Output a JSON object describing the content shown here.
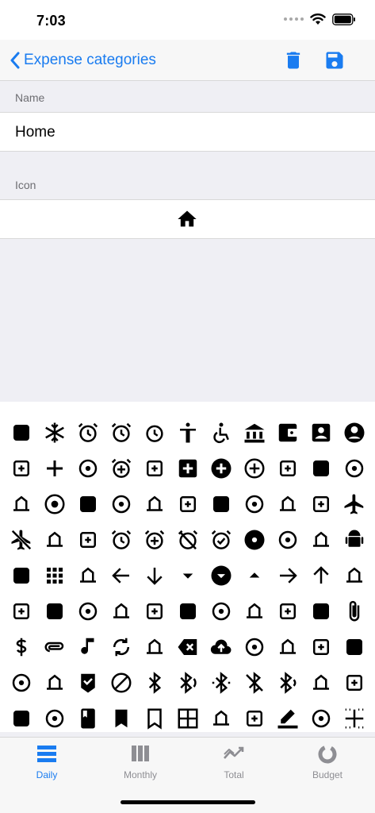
{
  "status_bar": {
    "time": "7:03"
  },
  "navbar": {
    "back_label": "Expense categories"
  },
  "form": {
    "name_header": "Name",
    "name_value": "Home",
    "icon_header": "Icon",
    "selected_icon": "home-icon"
  },
  "icon_picker": {
    "icons": [
      "3d-rotation-icon",
      "ac-unit-icon",
      "access-alarm-icon",
      "access-alarms-icon",
      "access-time-icon",
      "accessibility-icon",
      "accessible-icon",
      "account-balance-icon",
      "account-balance-wallet-icon",
      "account-box-icon",
      "account-circle-icon",
      "adb-icon",
      "add-icon",
      "add-a-photo-icon",
      "add-alarm-icon",
      "add-alert-icon",
      "add-box-icon",
      "add-circle-icon",
      "add-circle-outline-icon",
      "add-location-icon",
      "add-shopping-cart-icon",
      "add-to-photos-icon",
      "add-to-queue-icon",
      "adjust-icon",
      "airline-seat-flat-icon",
      "airline-seat-flat-angled-icon",
      "airline-seat-individual-suite-icon",
      "airline-seat-legroom-extra-icon",
      "airline-seat-legroom-normal-icon",
      "airline-seat-legroom-reduced-icon",
      "airline-seat-recline-extra-icon",
      "airline-seat-recline-normal-icon",
      "airplanemode-active-icon",
      "airplanemode-inactive-icon",
      "airplay-icon",
      "airport-shuttle-icon",
      "alarm-icon",
      "alarm-add-icon",
      "alarm-off-icon",
      "alarm-on-icon",
      "album-icon",
      "all-inclusive-icon",
      "all-out-icon",
      "android-icon",
      "announcement-icon",
      "apps-icon",
      "archive-icon",
      "arrow-back-icon",
      "arrow-downward-icon",
      "arrow-drop-down-icon",
      "arrow-drop-down-circle-icon",
      "arrow-drop-up-icon",
      "arrow-forward-icon",
      "arrow-upward-icon",
      "art-track-icon",
      "aspect-ratio-icon",
      "assessment-icon",
      "assignment-icon",
      "assignment-ind-icon",
      "assignment-late-icon",
      "assignment-return-icon",
      "assignment-returned-icon",
      "assignment-turned-in-icon",
      "assistant-icon",
      "assistant-photo-icon",
      "attach-file-icon",
      "attach-money-icon",
      "attachment-icon",
      "audiotrack-icon",
      "autorenew-icon",
      "av-timer-icon",
      "backspace-icon",
      "backup-icon",
      "battery-alert-icon",
      "battery-charging-full-icon",
      "battery-full-icon",
      "battery-std-icon",
      "battery-unknown-icon",
      "beach-access-icon",
      "beenhere-icon",
      "block-icon",
      "bluetooth-icon",
      "bluetooth-audio-icon",
      "bluetooth-connected-icon",
      "bluetooth-disabled-icon",
      "bluetooth-searching-icon",
      "blur-circular-icon",
      "blur-linear-icon",
      "blur-off-icon",
      "blur-on-icon",
      "book-icon",
      "bookmark-icon",
      "bookmark-border-icon",
      "border-all-icon",
      "border-bottom-icon",
      "border-clear-icon",
      "border-color-icon",
      "border-horizontal-icon",
      "border-inner-icon"
    ]
  },
  "tabs": [
    {
      "label": "Daily",
      "icon": "daily-icon",
      "active": true
    },
    {
      "label": "Monthly",
      "icon": "monthly-icon",
      "active": false
    },
    {
      "label": "Total",
      "icon": "total-icon",
      "active": false
    },
    {
      "label": "Budget",
      "icon": "budget-icon",
      "active": false
    }
  ],
  "colors": {
    "accent": "#1a7cf0",
    "inactive": "#8e8e93",
    "background": "#efeff4"
  }
}
